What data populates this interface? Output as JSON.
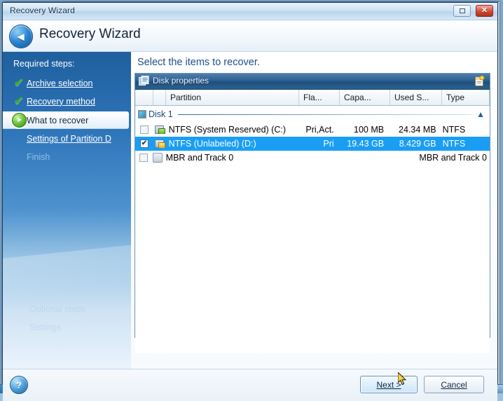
{
  "window": {
    "title": "Recovery Wizard",
    "header_title": "Recovery Wizard",
    "back_icon": "back-arrow-icon",
    "restore_icon": "restore-window-icon",
    "close_icon": "close-window-icon"
  },
  "sidebar": {
    "title": "Required steps:",
    "items": [
      {
        "label": "Archive selection",
        "state": "done",
        "icon": "green-check-icon"
      },
      {
        "label": "Recovery method",
        "state": "done",
        "icon": "green-check-icon"
      },
      {
        "label": "What to recover",
        "state": "current",
        "icon": "green-arrow-icon"
      },
      {
        "label": "Settings of Partition D",
        "state": "pending",
        "icon": "none"
      },
      {
        "label": "Finish",
        "state": "disabled",
        "icon": "none"
      }
    ],
    "faint": [
      {
        "label": "Optional steps"
      },
      {
        "label": "Settings"
      }
    ]
  },
  "content": {
    "title": "Select the items to recover.",
    "panel": {
      "header_title": "Disk properties",
      "header_icon": "disk-properties-icon",
      "header_right_icon": "properties-page-icon",
      "columns": [
        {
          "key": "check",
          "label": ""
        },
        {
          "key": "icon",
          "label": ""
        },
        {
          "key": "partition",
          "label": "Partition"
        },
        {
          "key": "flags",
          "label": "Fla..."
        },
        {
          "key": "capacity",
          "label": "Capa..."
        },
        {
          "key": "used",
          "label": "Used S..."
        },
        {
          "key": "type",
          "label": "Type"
        }
      ],
      "disk_group": {
        "label": "Disk 1",
        "icon": "hard-disk-icon",
        "collapse_icon": "chevron-up-icon"
      },
      "rows": [
        {
          "checked": false,
          "selected": false,
          "icon": "partition-green-icon",
          "partition": "NTFS (System Reserved) (C:)",
          "flags": "Pri,Act.",
          "capacity": "100 MB",
          "used": "24.34 MB",
          "type": "NTFS"
        },
        {
          "checked": true,
          "selected": true,
          "icon": "partition-gold-icon",
          "partition": "NTFS (Unlabeled) (D:)",
          "flags": "Pri",
          "capacity": "19.43 GB",
          "used": "8.429 GB",
          "type": "NTFS"
        },
        {
          "checked": false,
          "selected": false,
          "icon": "mbr-icon",
          "partition": "MBR and Track 0",
          "flags": "",
          "capacity": "",
          "used": "",
          "type": "MBR and Track 0"
        }
      ]
    }
  },
  "footer": {
    "help_icon": "help-question-icon",
    "next_label": "Next >",
    "cancel_label": "Cancel"
  },
  "colors": {
    "accent": "#1a9ef4",
    "sidebar_top": "#1f5f9e",
    "title_text": "#1d4e8c",
    "check_green": "#3fae20",
    "close_red": "#d24b34"
  }
}
